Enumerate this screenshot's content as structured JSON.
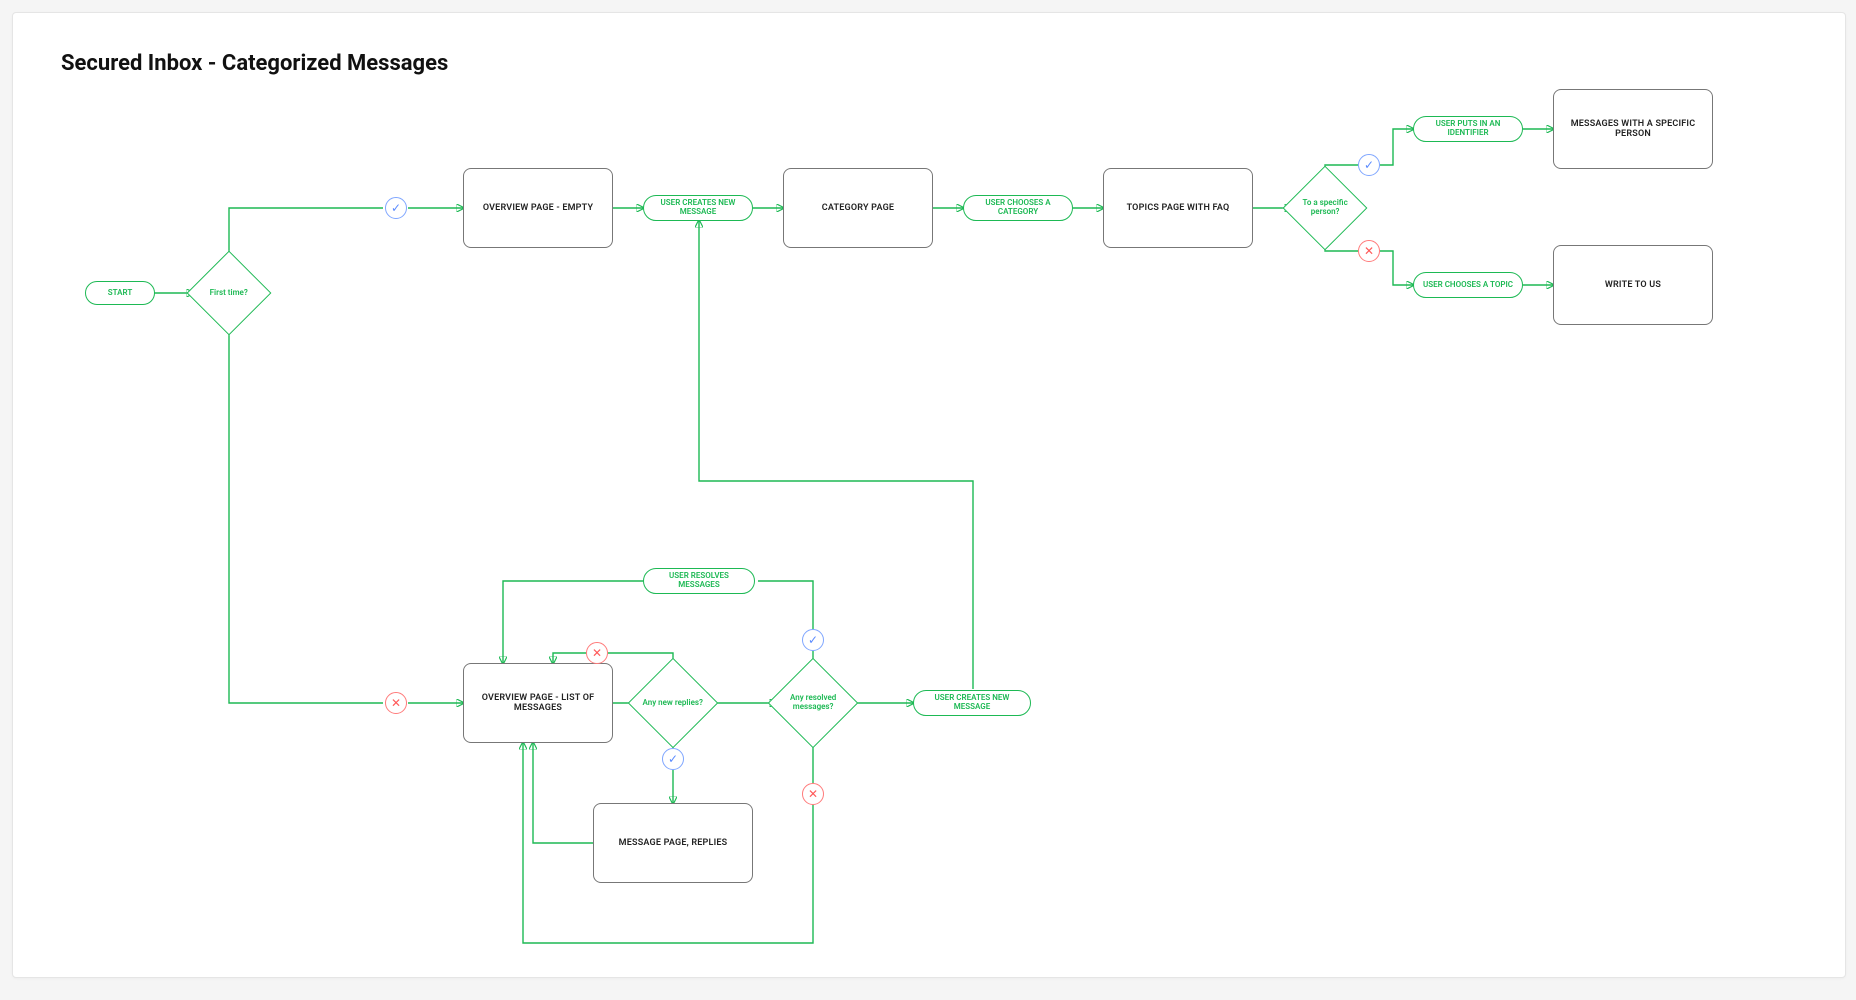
{
  "title": "Secured Inbox - Categorized Messages",
  "nodes": {
    "start": "START",
    "first_time": "First time?",
    "overview_empty": "OVERVIEW PAGE - EMPTY",
    "user_creates_new_1": "USER CREATES NEW MESSAGE",
    "category_page": "CATEGORY PAGE",
    "user_chooses_category": "USER CHOOSES A CATEGORY",
    "topics_page": "TOPICS PAGE WITH FAQ",
    "to_specific": "To a specific person?",
    "user_puts_identifier": "USER PUTS IN AN IDENTIFIER",
    "messages_specific": "MESSAGES WITH A SPECIFIC PERSON",
    "user_chooses_topic": "USER CHOOSES A TOPIC",
    "write_to_us": "WRITE TO US",
    "overview_list": "OVERVIEW PAGE - LIST OF MESSAGES",
    "any_new_replies": "Any new replies?",
    "any_resolved": "Any resolved messages?",
    "user_resolves": "USER RESOLVES MESSAGES",
    "user_creates_new_2": "USER CREATES NEW MESSAGE",
    "message_page": "MESSAGE PAGE, REPLIES"
  },
  "symbols": {
    "yes": "✓",
    "no": "✕"
  },
  "colors": {
    "green": "#1db954",
    "blue": "#7fa6ff",
    "red": "#ff7a7a",
    "box_border": "#777777"
  }
}
